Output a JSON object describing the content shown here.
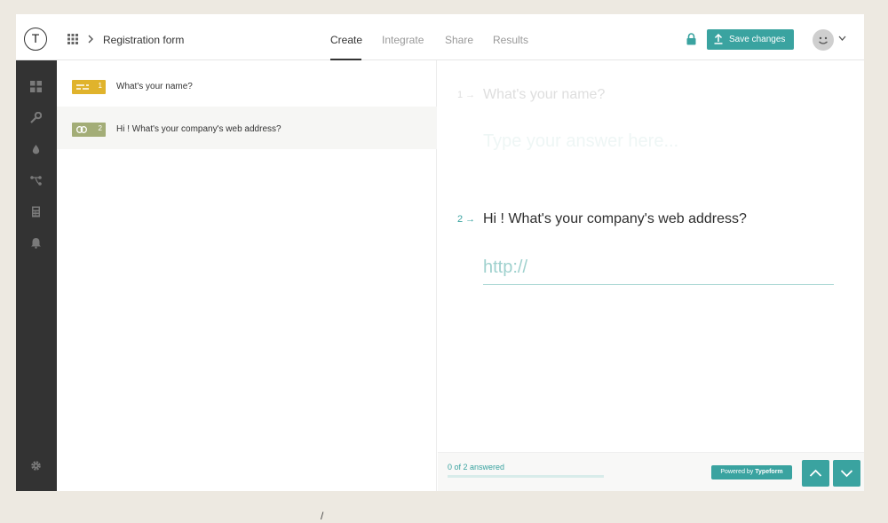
{
  "app": {
    "logo_letter": "T",
    "form_title": "Registration form"
  },
  "tabs": [
    {
      "label": "Create",
      "active": true
    },
    {
      "label": "Integrate",
      "active": false
    },
    {
      "label": "Share",
      "active": false
    },
    {
      "label": "Results",
      "active": false
    }
  ],
  "header": {
    "save_label": "Save changes"
  },
  "colors": {
    "accent": "#3aa3a0",
    "badge_text_question": "#e0b32c",
    "badge_website_question": "#a3ad77",
    "sidebar": "#333333"
  },
  "sidebar": {
    "icons": [
      "grid-icon",
      "wrench-icon",
      "drop-icon",
      "branch-icon",
      "calculator-icon",
      "bell-icon",
      "gear-icon"
    ]
  },
  "questions": [
    {
      "number": "1",
      "text": "What's your  name?",
      "icon": "short-text-icon",
      "color": "#e0b32c"
    },
    {
      "number": "2",
      "text": "Hi ! What's your company's web address?",
      "icon": "link-icon",
      "color": "#a3ad77"
    }
  ],
  "preview": {
    "q1_number": "1 →",
    "q1_title": "What's your name?",
    "q1_placeholder": "Type your answer here...",
    "q2_number": "2 →",
    "q2_title": "Hi ! What's your company's web address?",
    "q2_placeholder": "http://"
  },
  "footer": {
    "progress_text": "0 of 2 answered",
    "progress_fraction": 0,
    "powered_prefix": "Powered by ",
    "powered_brand": "Typeform"
  },
  "stray_text": "/"
}
